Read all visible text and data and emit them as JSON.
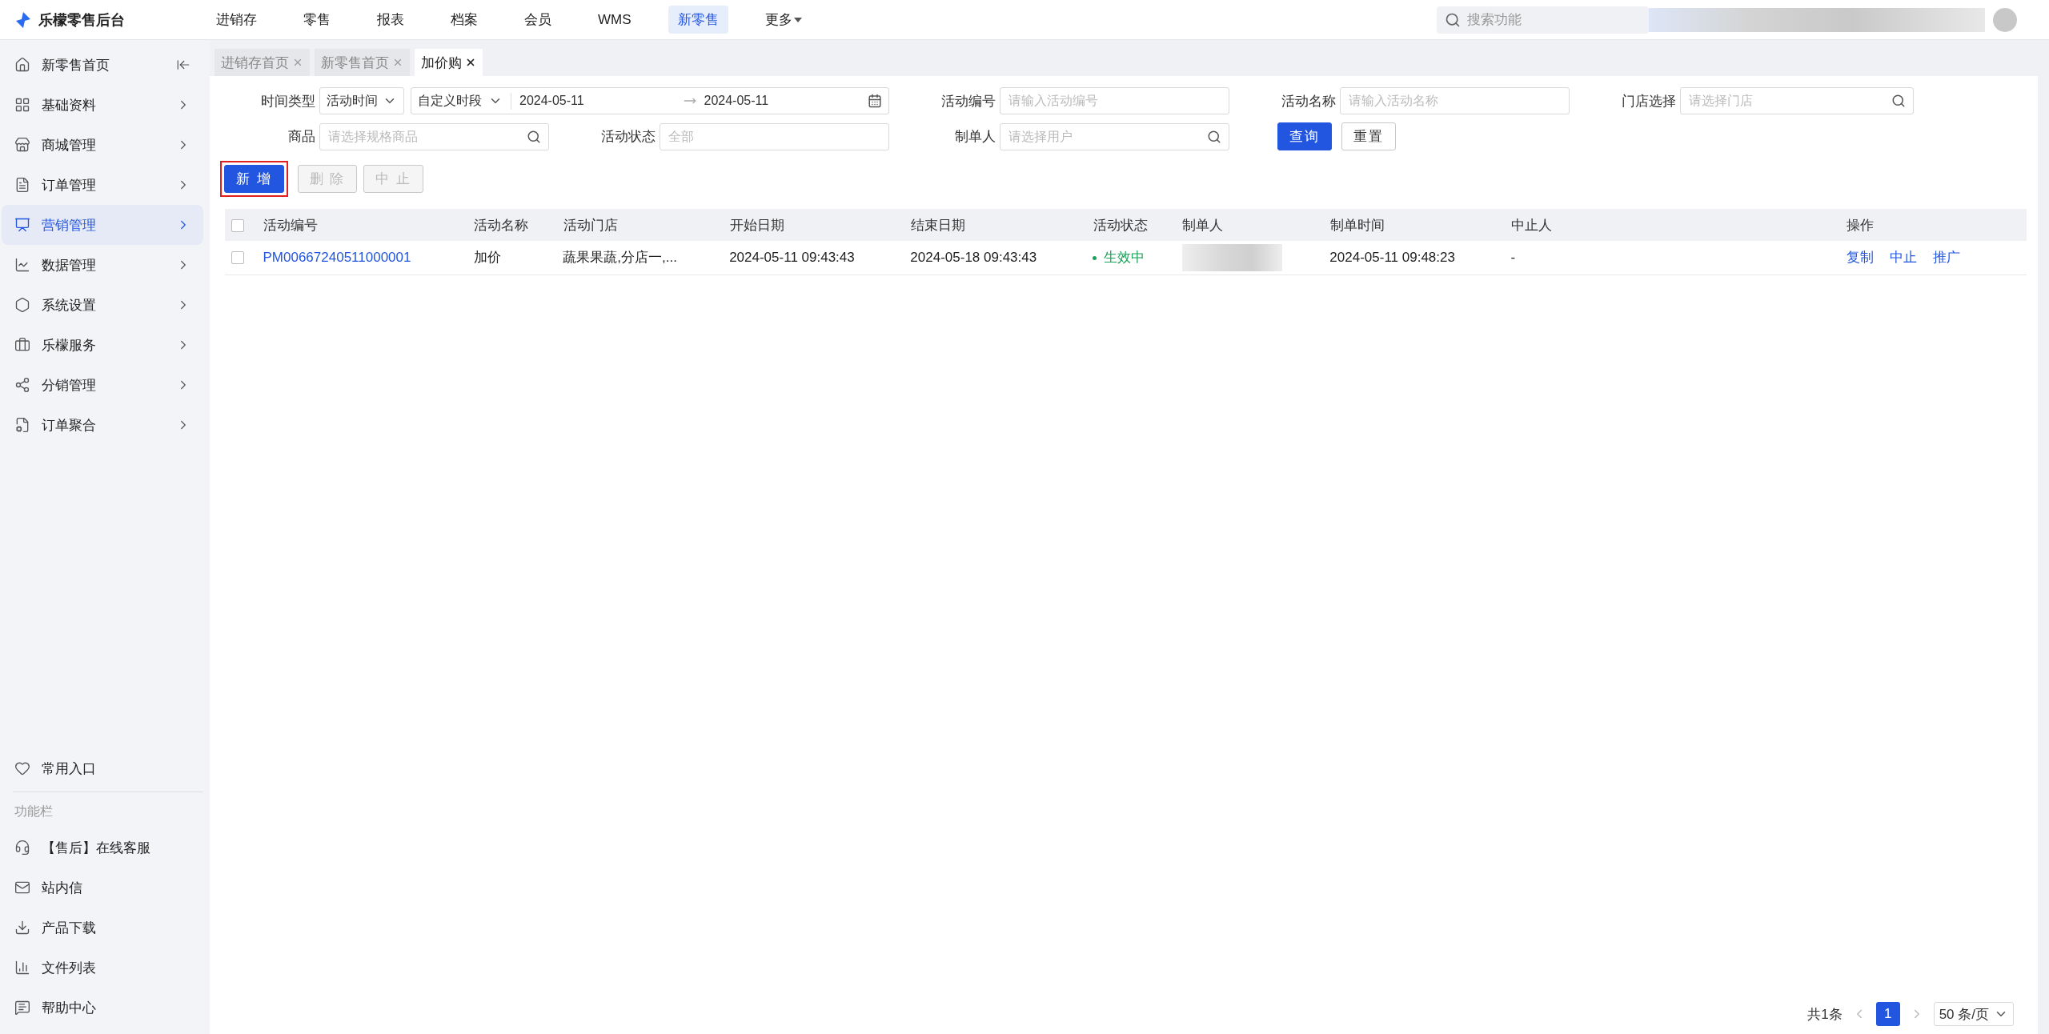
{
  "app": {
    "logo_text": "乐檬零售后台"
  },
  "top_nav": [
    {
      "label": "进销存",
      "selected": false,
      "kind": "link"
    },
    {
      "label": "零售",
      "selected": false,
      "kind": "link"
    },
    {
      "label": "报表",
      "selected": false,
      "kind": "link"
    },
    {
      "label": "档案",
      "selected": false,
      "kind": "link"
    },
    {
      "label": "会员",
      "selected": false,
      "kind": "link"
    },
    {
      "label": "WMS",
      "selected": false,
      "kind": "link"
    },
    {
      "label": "新零售",
      "selected": true,
      "kind": "link"
    },
    {
      "label": "更多",
      "selected": false,
      "kind": "dropdown"
    }
  ],
  "search": {
    "placeholder": "搜索功能"
  },
  "sidebar": {
    "items": [
      {
        "label": "新零售首页",
        "selected": false,
        "kind": "home"
      },
      {
        "label": "基础资料",
        "selected": false,
        "kind": "menu"
      },
      {
        "label": "商城管理",
        "selected": false,
        "kind": "menu"
      },
      {
        "label": "订单管理",
        "selected": false,
        "kind": "menu"
      },
      {
        "label": "营销管理",
        "selected": true,
        "kind": "menu"
      },
      {
        "label": "数据管理",
        "selected": false,
        "kind": "menu"
      },
      {
        "label": "系统设置",
        "selected": false,
        "kind": "menu"
      },
      {
        "label": "乐檬服务",
        "selected": false,
        "kind": "menu"
      },
      {
        "label": "分销管理",
        "selected": false,
        "kind": "menu"
      },
      {
        "label": "订单聚合",
        "selected": false,
        "kind": "menu"
      }
    ],
    "favorites": "常用入口",
    "section_title": "功能栏",
    "tools": [
      "【售后】在线客服",
      "站内信",
      "产品下载",
      "文件列表",
      "帮助中心"
    ]
  },
  "tabs": [
    {
      "label": "进销存首页",
      "selected": false
    },
    {
      "label": "新零售首页",
      "selected": false
    },
    {
      "label": "加价购",
      "selected": true
    }
  ],
  "filters": [
    {
      "label": "时间类型",
      "kind": "time_range",
      "select": "活动时间",
      "period": "自定义时段",
      "start": "2024-05-11",
      "end": "2024-05-11"
    },
    {
      "label": "活动编号",
      "kind": "input",
      "placeholder": "请输入活动编号"
    },
    {
      "label": "活动名称",
      "kind": "input",
      "placeholder": "请输入活动名称"
    },
    {
      "label": "门店选择",
      "kind": "search",
      "placeholder": "请选择门店"
    },
    {
      "label": "商品",
      "kind": "search",
      "placeholder": "请选择规格商品"
    },
    {
      "label": "活动状态",
      "kind": "input",
      "placeholder": "全部"
    },
    {
      "label": "制单人",
      "kind": "search",
      "placeholder": "请选择用户"
    }
  ],
  "filter_buttons": [
    {
      "label": "查询",
      "kind": "primary"
    },
    {
      "label": "重置",
      "kind": "default"
    }
  ],
  "actions": [
    {
      "label": "新 增",
      "disabled": false,
      "highlighted": true
    },
    {
      "label": "删 除",
      "disabled": true,
      "highlighted": false
    },
    {
      "label": "中 止",
      "disabled": true,
      "highlighted": false
    }
  ],
  "table": {
    "all_checked": false,
    "columns": [
      "活动编号",
      "活动名称",
      "活动门店",
      "开始日期",
      "结束日期",
      "活动状态",
      "制单人",
      "制单时间",
      "中止人",
      "操作"
    ],
    "rows": [
      {
        "selected": false,
        "cells": [
          {
            "kind": "link",
            "text": "PM00667240511000001"
          },
          {
            "kind": "text",
            "text": "加价"
          },
          {
            "kind": "text",
            "text": "蔬果果蔬,分店一,..."
          },
          {
            "kind": "text",
            "text": "2024-05-11 09:43:43"
          },
          {
            "kind": "text",
            "text": "2024-05-18 09:43:43"
          },
          {
            "kind": "status",
            "text": "生效中",
            "color": "#1aa35a"
          },
          {
            "kind": "redacted"
          },
          {
            "kind": "text",
            "text": "2024-05-11 09:48:23"
          },
          {
            "kind": "text",
            "text": "-"
          },
          {
            "kind": "actions",
            "links": [
              "复制",
              "中止",
              "推广"
            ]
          }
        ]
      }
    ]
  },
  "pagination": {
    "total": "共1条",
    "pages": [
      {
        "label": "1",
        "selected": true
      }
    ],
    "page_size": "50 条/页"
  }
}
